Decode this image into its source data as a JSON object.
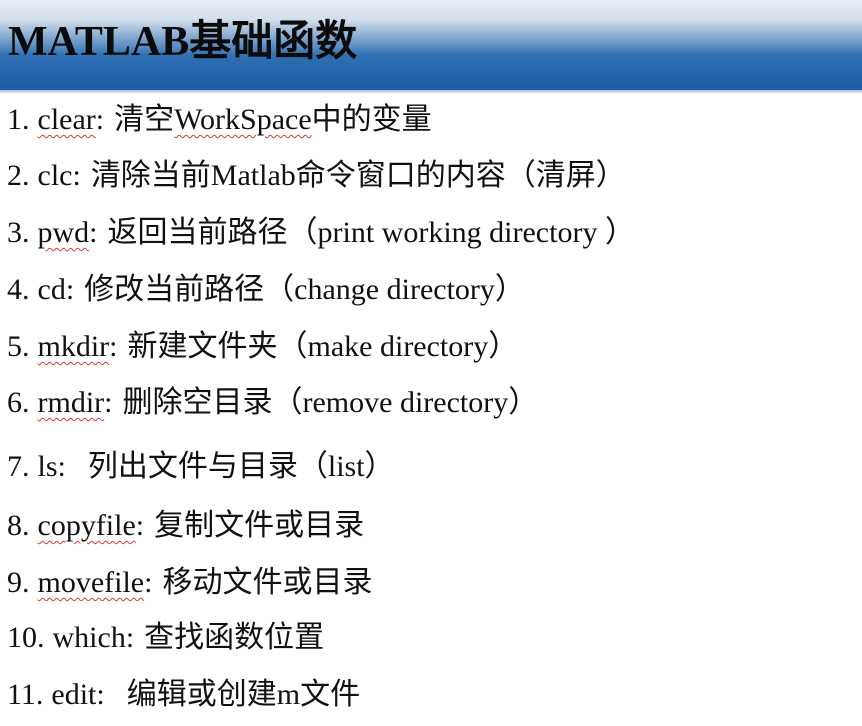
{
  "slide": {
    "title": "MATLAB基础函数",
    "items": [
      {
        "num": "1.",
        "fn": "clear",
        "sep": ":",
        "desc_before": "清空",
        "desc_underlined": "WorkSpace",
        "desc_after": "中的变量"
      },
      {
        "num": "2.",
        "fn": "clc",
        "sep": ":",
        "desc_before": "清除当前Matlab命令窗口的内容（清屏）",
        "desc_underlined": "",
        "desc_after": ""
      },
      {
        "num": "3.",
        "fn": "pwd",
        "sep": ":",
        "desc_before": "返回当前路径（print working directory ）",
        "desc_underlined": "",
        "desc_after": ""
      },
      {
        "num": "4.",
        "fn": "cd",
        "sep": ":",
        "desc_before": "修改当前路径（change directory）",
        "desc_underlined": "",
        "desc_after": ""
      },
      {
        "num": "5.",
        "fn": "mkdir",
        "sep": ":",
        "desc_before": "新建文件夹（make directory）",
        "desc_underlined": "",
        "desc_after": ""
      },
      {
        "num": "6.",
        "fn": "rmdir",
        "sep": ":",
        "desc_before": "删除空目录（remove directory）",
        "desc_underlined": "",
        "desc_after": ""
      },
      {
        "num": "7.",
        "fn": "ls",
        "sep": ":",
        "desc_before": "列出文件与目录（list）",
        "desc_underlined": "",
        "desc_after": ""
      },
      {
        "num": "8.",
        "fn": "copyfile",
        "sep": ":",
        "desc_before": "复制文件或目录",
        "desc_underlined": "",
        "desc_after": ""
      },
      {
        "num": "9.",
        "fn": "movefile",
        "sep": ":",
        "desc_before": "移动文件或目录",
        "desc_underlined": "",
        "desc_after": ""
      },
      {
        "num": "10.",
        "fn": "which",
        "sep": ":",
        "desc_before": "查找函数位置",
        "desc_underlined": "",
        "desc_after": ""
      },
      {
        "num": "11.",
        "fn": "edit",
        "sep": ":",
        "desc_before": "编辑或创建m文件",
        "desc_underlined": "",
        "desc_after": ""
      }
    ]
  },
  "colors": {
    "title_band": "#1b5ea6",
    "spell_underline": "#d23b3b",
    "text": "#111111"
  }
}
